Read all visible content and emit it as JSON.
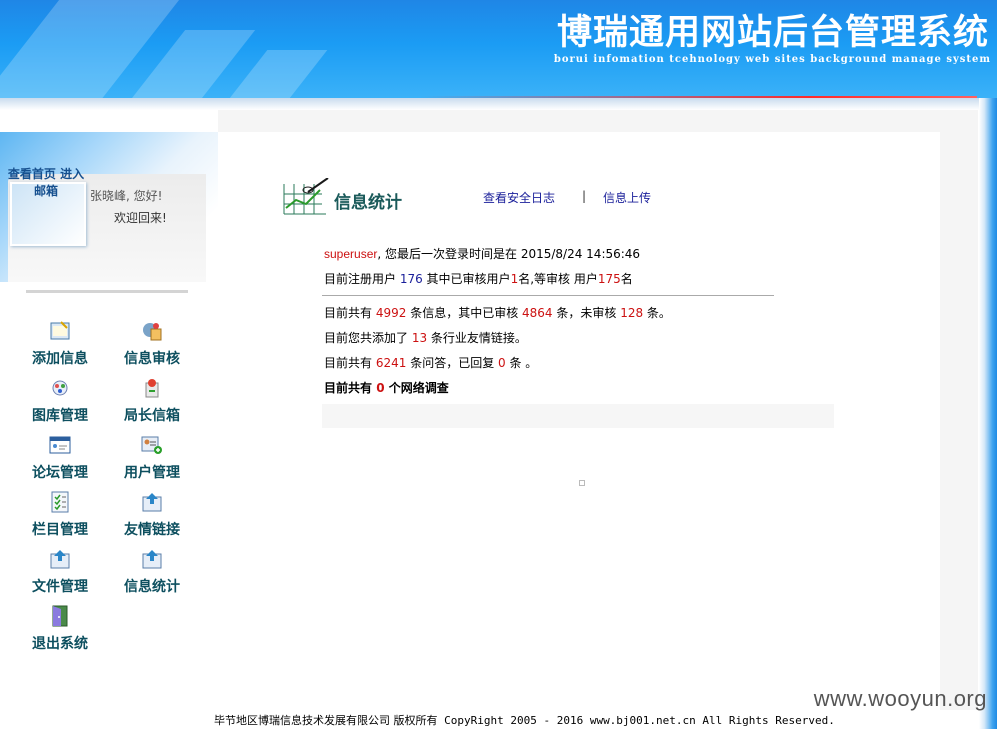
{
  "header": {
    "title": "博瑞通用网站后台管理系统",
    "subtitle": "borui infomation tcehnology web sites background manage system"
  },
  "sidebar": {
    "home_link": "查看首页  进入邮箱",
    "greeting": "张晓峰, 您好!",
    "welcome": "欢迎回来!",
    "items": [
      {
        "label": "添加信息",
        "icon": "add-info-icon"
      },
      {
        "label": "信息审核",
        "icon": "review-icon"
      },
      {
        "label": "图库管理",
        "icon": "gallery-icon"
      },
      {
        "label": "局长信箱",
        "icon": "mailbox-icon"
      },
      {
        "label": "论坛管理",
        "icon": "forum-icon"
      },
      {
        "label": "用户管理",
        "icon": "user-icon"
      },
      {
        "label": "栏目管理",
        "icon": "column-icon"
      },
      {
        "label": "友情链接",
        "icon": "link-icon"
      },
      {
        "label": "文件管理",
        "icon": "file-icon"
      },
      {
        "label": "信息统计",
        "icon": "stats-icon"
      },
      {
        "label": "退出系统",
        "icon": "logout-icon"
      }
    ]
  },
  "main": {
    "section_title": "信息统计",
    "links": {
      "security_log": "查看安全日志",
      "separator": "|",
      "upload": "信息上传"
    },
    "last_login": {
      "user": "superuser",
      "text": ", 您最后一次登录时间是在 ",
      "time": "2015/8/24 14:56:46"
    },
    "users": {
      "prefix": "目前注册用户 ",
      "total": "176",
      "mid": " 其中已审核用户",
      "approved": "1",
      "mid2": "名,等审核 用户",
      "pending": "175",
      "suffix": "名"
    },
    "info": {
      "prefix": "目前共有 ",
      "total": "4992",
      "mid": " 条信息，其中已审核 ",
      "approved": "4864",
      "mid2": " 条，未审核 ",
      "pending": "128",
      "suffix": " 条。"
    },
    "links_count": {
      "prefix": "目前您共添加了 ",
      "count": "13",
      "suffix": " 条行业友情链接。"
    },
    "qa": {
      "prefix": "目前共有 ",
      "total": "6241",
      "mid": " 条问答，已回复 ",
      "replied": "0",
      "suffix": " 条 。"
    },
    "survey": {
      "prefix": "目前共有 ",
      "count": "0",
      "suffix": " 个网络调查"
    }
  },
  "footer": {
    "company": "毕节地区博瑞信息技术发展有限公司 版权所有",
    "copyright": " CopyRight 2005 - 2016 www.bj001.net.cn All Rights Reserved."
  },
  "watermark": "www.wooyun.org"
}
